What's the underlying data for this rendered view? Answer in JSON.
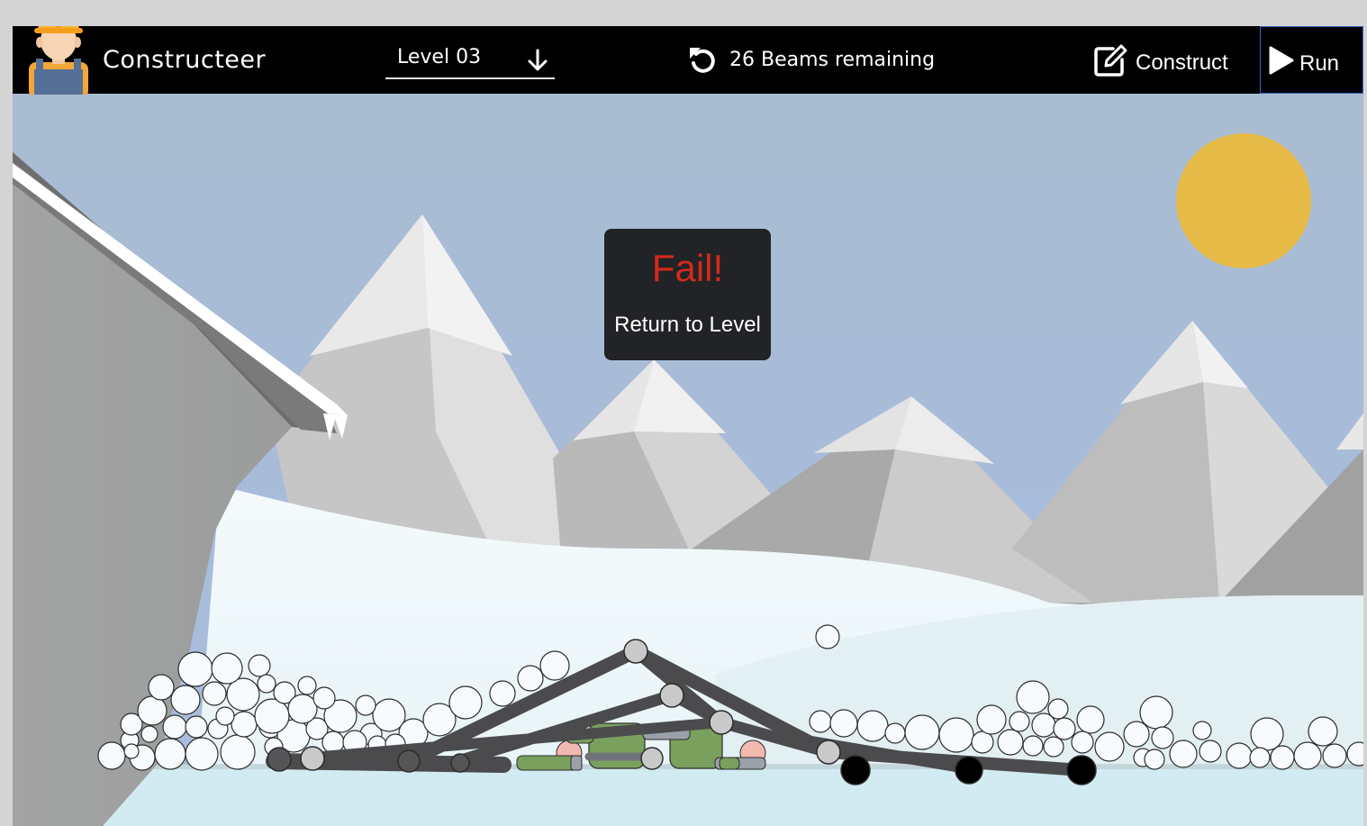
{
  "app": {
    "title": "Constructeer"
  },
  "level_select": {
    "label": "Level 03"
  },
  "beams": {
    "remaining_text": "26 Beams remaining",
    "remaining": 26
  },
  "toolbar": {
    "construct_label": "Construct",
    "run_label": "Run"
  },
  "dialog": {
    "title": "Fail!",
    "action_label": "Return to Level"
  },
  "icons": [
    "avatar-icon",
    "chevron-down-icon",
    "undo-icon",
    "edit-icon",
    "play-icon"
  ],
  "colors": {
    "topbar": "#000000",
    "fail_text": "#d42a1c",
    "dialog_bg": "#222326",
    "sky": "#aabdd6",
    "sun": "#e7bb48",
    "beam": "#4b4b4d",
    "troll": "#7aa05d",
    "run_border": "#3d63c9"
  }
}
